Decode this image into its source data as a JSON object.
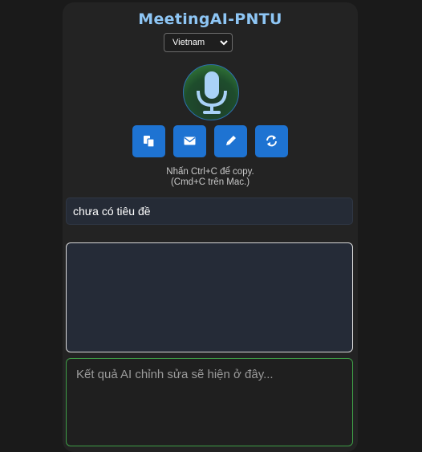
{
  "app": {
    "title": "MeetingAI-PNTU"
  },
  "language": {
    "selected": "Vietnam"
  },
  "icons": {
    "mic": "microphone-icon",
    "copy": "copy-icon",
    "email": "envelope-icon",
    "edit": "pencil-icon",
    "refresh": "sync-icon"
  },
  "hint": {
    "line1": "Nhấn Ctrl+C để copy.",
    "line2": "(Cmd+C trên Mac.)"
  },
  "meeting_title": {
    "value": "chưa có tiêu đề"
  },
  "transcript": {
    "value": ""
  },
  "ai_result": {
    "placeholder": "Kết quả AI chỉnh sửa sẽ hiện ở đây..."
  },
  "colors": {
    "accent": "#1e73d2",
    "title": "#8ec6f5",
    "result_border": "#3e9d46",
    "mic_icon": "#a9d2f7"
  }
}
